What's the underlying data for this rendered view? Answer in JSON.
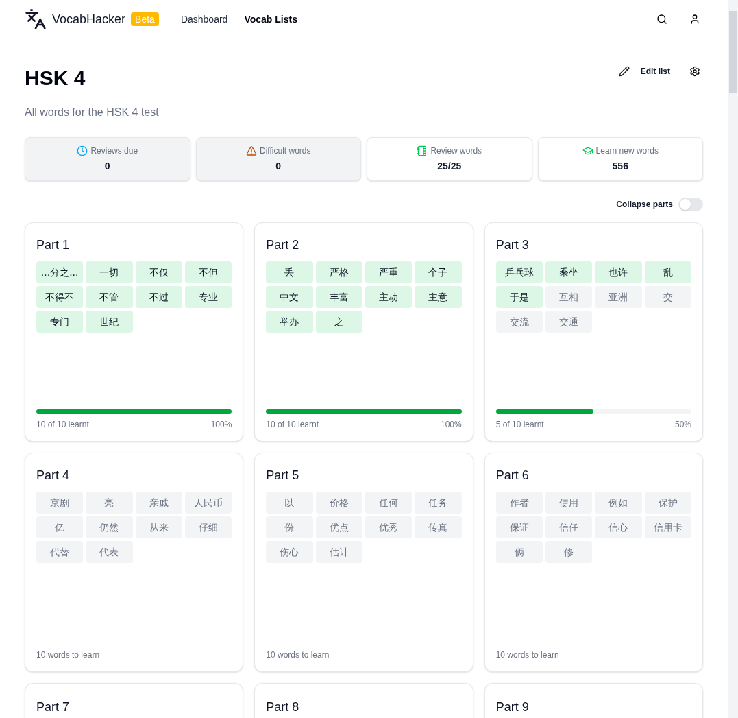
{
  "header": {
    "brand": "VocabHacker",
    "badge": "Beta",
    "nav": [
      {
        "label": "Dashboard",
        "selected": false
      },
      {
        "label": "Vocab Lists",
        "selected": true
      }
    ]
  },
  "list": {
    "title": "HSK 4",
    "description": "All words for the HSK 4 test",
    "edit_label": "Edit list"
  },
  "stats": [
    {
      "kind": "reviews",
      "label": "Reviews due",
      "value": "0",
      "disabled": true
    },
    {
      "kind": "difficult",
      "label": "Difficult words",
      "value": "0",
      "disabled": true
    },
    {
      "kind": "review",
      "label": "Review words",
      "value": "25/25",
      "disabled": false
    },
    {
      "kind": "learn",
      "label": "Learn new words",
      "value": "556",
      "disabled": false
    }
  ],
  "collapse": {
    "label": "Collapse parts",
    "on": false
  },
  "parts": [
    {
      "title": "Part 1",
      "kind": "progress",
      "words": [
        {
          "text": "...分之...",
          "learnt": true
        },
        {
          "text": "一切",
          "learnt": true
        },
        {
          "text": "不仅",
          "learnt": true
        },
        {
          "text": "不但",
          "learnt": true
        },
        {
          "text": "不得不",
          "learnt": true
        },
        {
          "text": "不管",
          "learnt": true
        },
        {
          "text": "不过",
          "learnt": true
        },
        {
          "text": "专业",
          "learnt": true
        },
        {
          "text": "专门",
          "learnt": true
        },
        {
          "text": "世纪",
          "learnt": true
        }
      ],
      "status": "10 of 10 learnt",
      "percent": "100%",
      "level": 1
    },
    {
      "title": "Part 2",
      "kind": "progress",
      "words": [
        {
          "text": "丢",
          "learnt": true
        },
        {
          "text": "严格",
          "learnt": true
        },
        {
          "text": "严重",
          "learnt": true
        },
        {
          "text": "个子",
          "learnt": true
        },
        {
          "text": "中文",
          "learnt": true
        },
        {
          "text": "丰富",
          "learnt": true
        },
        {
          "text": "主动",
          "learnt": true
        },
        {
          "text": "主意",
          "learnt": true
        },
        {
          "text": "举办",
          "learnt": true
        },
        {
          "text": "之",
          "learnt": true
        }
      ],
      "status": "10 of 10 learnt",
      "percent": "100%",
      "level": 1
    },
    {
      "title": "Part 3",
      "kind": "progress",
      "words": [
        {
          "text": "乒乓球",
          "learnt": true
        },
        {
          "text": "乘坐",
          "learnt": true
        },
        {
          "text": "也许",
          "learnt": true
        },
        {
          "text": "乱",
          "learnt": true
        },
        {
          "text": "于是",
          "learnt": true
        },
        {
          "text": "互相",
          "learnt": false
        },
        {
          "text": "亚洲",
          "learnt": false
        },
        {
          "text": "交",
          "learnt": false
        },
        {
          "text": "交流",
          "learnt": false
        },
        {
          "text": "交通",
          "learnt": false
        }
      ],
      "status": "5 of 10 learnt",
      "percent": "50%",
      "level": 0.5
    },
    {
      "title": "Part 4",
      "kind": "todo",
      "words": [
        {
          "text": "京剧",
          "learnt": false
        },
        {
          "text": "亮",
          "learnt": false
        },
        {
          "text": "亲戚",
          "learnt": false
        },
        {
          "text": "人民币",
          "learnt": false
        },
        {
          "text": "亿",
          "learnt": false
        },
        {
          "text": "仍然",
          "learnt": false
        },
        {
          "text": "从来",
          "learnt": false
        },
        {
          "text": "仔细",
          "learnt": false
        },
        {
          "text": "代替",
          "learnt": false
        },
        {
          "text": "代表",
          "learnt": false
        }
      ],
      "status": "10 words to learn"
    },
    {
      "title": "Part 5",
      "kind": "todo",
      "words": [
        {
          "text": "以",
          "learnt": false
        },
        {
          "text": "价格",
          "learnt": false
        },
        {
          "text": "任何",
          "learnt": false
        },
        {
          "text": "任务",
          "learnt": false
        },
        {
          "text": "份",
          "learnt": false
        },
        {
          "text": "优点",
          "learnt": false
        },
        {
          "text": "优秀",
          "learnt": false
        },
        {
          "text": "传真",
          "learnt": false
        },
        {
          "text": "伤心",
          "learnt": false
        },
        {
          "text": "估计",
          "learnt": false
        }
      ],
      "status": "10 words to learn"
    },
    {
      "title": "Part 6",
      "kind": "todo",
      "words": [
        {
          "text": "作者",
          "learnt": false
        },
        {
          "text": "使用",
          "learnt": false
        },
        {
          "text": "例如",
          "learnt": false
        },
        {
          "text": "保护",
          "learnt": false
        },
        {
          "text": "保证",
          "learnt": false
        },
        {
          "text": "信任",
          "learnt": false
        },
        {
          "text": "信心",
          "learnt": false
        },
        {
          "text": "信用卡",
          "learnt": false
        },
        {
          "text": "俩",
          "learnt": false
        },
        {
          "text": "修",
          "learnt": false
        }
      ],
      "status": "10 words to learn"
    },
    {
      "title": "Part 7",
      "kind": "cut"
    },
    {
      "title": "Part 8",
      "kind": "cut"
    },
    {
      "title": "Part 9",
      "kind": "cut"
    }
  ]
}
